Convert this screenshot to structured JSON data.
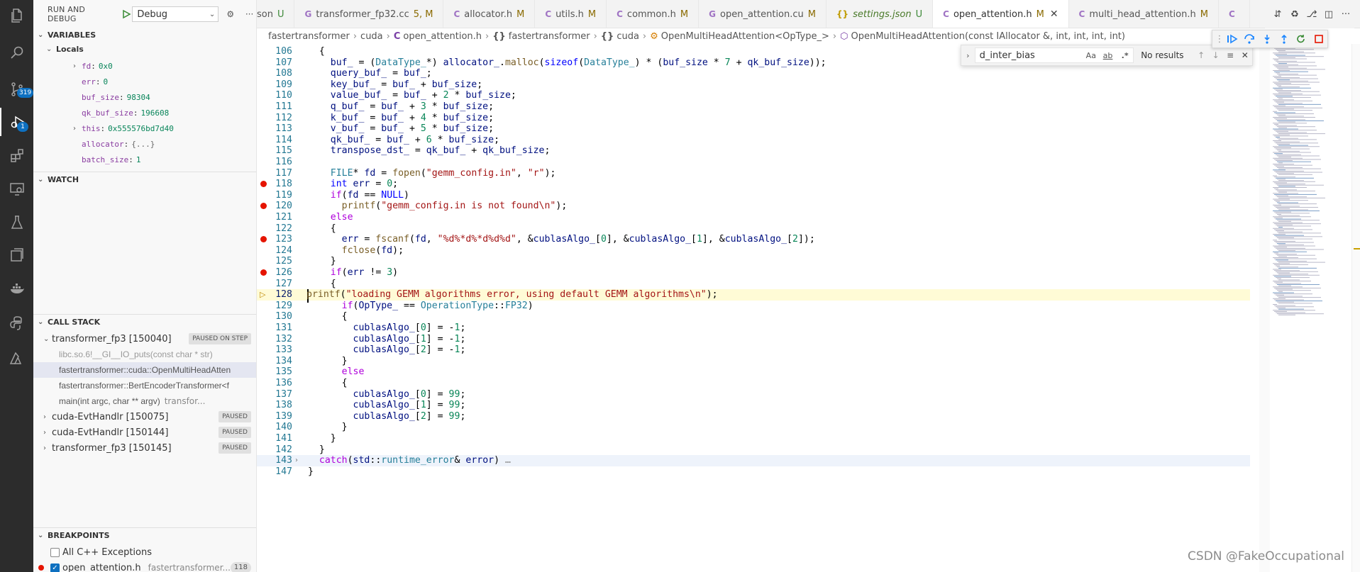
{
  "activity_bar": {
    "scm_badge": "319",
    "debug_badge": "1"
  },
  "sidebar": {
    "title": "RUN AND DEBUG",
    "config": "Debug",
    "variables_header": "VARIABLES",
    "locals_header": "Locals",
    "variables": [
      {
        "name": "fd",
        "value": "0x0",
        "expandable": true
      },
      {
        "name": "err",
        "value": "0",
        "expandable": false
      },
      {
        "name": "buf_size",
        "value": "98304",
        "expandable": false
      },
      {
        "name": "qk_buf_size",
        "value": "196608",
        "expandable": false
      },
      {
        "name": "this",
        "value": "0x555576bd7d40",
        "expandable": true
      },
      {
        "name": "allocator",
        "value": "{...}",
        "expandable": false
      },
      {
        "name": "batch_size",
        "value": "1",
        "expandable": false
      }
    ],
    "watch_header": "WATCH",
    "callstack_header": "CALL STACK",
    "callstack": [
      {
        "label": "transformer_fp3 [150040]",
        "badge": "PAUSED ON STEP",
        "kind": "thread",
        "expanded": true
      },
      {
        "label": "libc.so.6!__GI__IO_puts(const char * str)",
        "badge": "",
        "kind": "frame"
      },
      {
        "label": "fastertransformer::cuda::OpenMultiHeadAtten",
        "badge": "",
        "kind": "frame",
        "selected": true
      },
      {
        "label": "fastertransformer::BertEncoderTransformer<f",
        "badge": "",
        "kind": "frame"
      },
      {
        "label": "main(int argc, char ** argv)",
        "file": "transfor...",
        "badge": "",
        "kind": "frame"
      },
      {
        "label": "cuda-EvtHandlr [150075]",
        "badge": "PAUSED",
        "kind": "thread",
        "expanded": false
      },
      {
        "label": "cuda-EvtHandlr [150144]",
        "badge": "PAUSED",
        "kind": "thread",
        "expanded": false
      },
      {
        "label": "transformer_fp3 [150145]",
        "badge": "PAUSED",
        "kind": "thread",
        "expanded": false
      }
    ],
    "breakpoints_header": "BREAKPOINTS",
    "breakpoints": [
      {
        "label": "All C++ Exceptions",
        "checked": false
      },
      {
        "label": "open_attention.h",
        "path": "fastertransformer...",
        "line": "118",
        "checked": true
      }
    ]
  },
  "tabs": [
    {
      "label": "son",
      "status": "U",
      "icon": "",
      "icon_color": "#c09b00"
    },
    {
      "label": "transformer_fp32.cc",
      "status": "5, M",
      "icon": "G",
      "icon_color": "#a074c4"
    },
    {
      "label": "allocator.h",
      "status": "M",
      "icon": "C",
      "icon_color": "#a074c4"
    },
    {
      "label": "utils.h",
      "status": "M",
      "icon": "C",
      "icon_color": "#a074c4"
    },
    {
      "label": "common.h",
      "status": "M",
      "icon": "C",
      "icon_color": "#a074c4"
    },
    {
      "label": "open_attention.cu",
      "status": "M",
      "icon": "G",
      "icon_color": "#a074c4"
    },
    {
      "label": "settings.json",
      "status": "U",
      "icon": "{}",
      "icon_color": "#c09b00"
    },
    {
      "label": "open_attention.h",
      "status": "M",
      "icon": "C",
      "icon_color": "#a074c4",
      "active": true
    },
    {
      "label": "multi_head_attention.h",
      "status": "M",
      "icon": "C",
      "icon_color": "#a074c4"
    },
    {
      "label": "",
      "status": "",
      "icon": "C",
      "icon_color": "#a074c4"
    }
  ],
  "breadcrumb": [
    "fastertransformer",
    "cuda",
    "open_attention.h",
    "fastertransformer",
    "cuda",
    "OpenMultiHeadAttention<OpType_>",
    "OpenMultiHeadAttention(const IAllocator &, int, int, int, int)"
  ],
  "find": {
    "query": "d_inter_bias",
    "opt_case": "Aa",
    "opt_word": "ab",
    "opt_regex": ".*",
    "result": "No results"
  },
  "code_lines": [
    {
      "n": "106",
      "bp": false,
      "html": "  <span>{</span>"
    },
    {
      "n": "107",
      "bp": false,
      "html": "    <span class='id'>buf_</span> = (<span class='ty'>DataType_</span>*) <span class='id'>allocator_</span>.<span class='fn'>malloc</span>(<span class='kw'>sizeof</span>(<span class='ty'>DataType_</span>) * (<span class='id'>buf_size</span> * <span class='num'>7</span> + <span class='id'>qk_buf_size</span>));"
    },
    {
      "n": "108",
      "bp": false,
      "html": "    <span class='id'>query_buf_</span> = <span class='id'>buf_</span>;"
    },
    {
      "n": "109",
      "bp": false,
      "html": "    <span class='id'>key_buf_</span> = <span class='id'>buf_</span> + <span class='id'>buf_size</span>;"
    },
    {
      "n": "110",
      "bp": false,
      "html": "    <span class='id'>value_buf_</span> = <span class='id'>buf_</span> + <span class='num'>2</span> * <span class='id'>buf_size</span>;"
    },
    {
      "n": "111",
      "bp": false,
      "html": "    <span class='id'>q_buf_</span> = <span class='id'>buf_</span> + <span class='num'>3</span> * <span class='id'>buf_size</span>;"
    },
    {
      "n": "112",
      "bp": false,
      "html": "    <span class='id'>k_buf_</span> = <span class='id'>buf_</span> + <span class='num'>4</span> * <span class='id'>buf_size</span>;"
    },
    {
      "n": "113",
      "bp": false,
      "html": "    <span class='id'>v_buf_</span> = <span class='id'>buf_</span> + <span class='num'>5</span> * <span class='id'>buf_size</span>;"
    },
    {
      "n": "114",
      "bp": false,
      "html": "    <span class='id'>qk_buf_</span> = <span class='id'>buf_</span> + <span class='num'>6</span> * <span class='id'>buf_size</span>;"
    },
    {
      "n": "115",
      "bp": false,
      "html": "    <span class='id'>transpose_dst_</span> = <span class='id'>qk_buf_</span> + <span class='id'>qk_buf_size</span>;"
    },
    {
      "n": "116",
      "bp": false,
      "html": ""
    },
    {
      "n": "117",
      "bp": false,
      "html": "    <span class='ty'>FILE</span>* <span class='id'>fd</span> = <span class='fn'>fopen</span>(<span class='str'>\"gemm_config.in\"</span>, <span class='str'>\"r\"</span>);"
    },
    {
      "n": "118",
      "bp": true,
      "html": "    <span class='kw'>int</span> <span class='id'>err</span> = <span class='num'>0</span>;"
    },
    {
      "n": "119",
      "bp": false,
      "html": "    <span class='kwc'>if</span>(<span class='id'>fd</span> == <span class='kw'>NULL</span>)"
    },
    {
      "n": "120",
      "bp": true,
      "html": "      <span class='fn'>printf</span>(<span class='str'>\"gemm_config.in is not found\\n\"</span>);"
    },
    {
      "n": "121",
      "bp": false,
      "html": "    <span class='kwc'>else</span>"
    },
    {
      "n": "122",
      "bp": false,
      "html": "    <span>{</span>"
    },
    {
      "n": "123",
      "bp": true,
      "html": "      <span class='id'>err</span> = <span class='fn'>fscanf</span>(<span class='id'>fd</span>, <span class='str'>\"%d%*d%*d%d%d\"</span>, &amp;<span class='id'>cublasAlgo_</span>[<span class='num'>0</span>], &amp;<span class='id'>cublasAlgo_</span>[<span class='num'>1</span>], &amp;<span class='id'>cublasAlgo_</span>[<span class='num'>2</span>]);"
    },
    {
      "n": "124",
      "bp": false,
      "html": "      <span class='fn'>fclose</span>(<span class='id'>fd</span>);"
    },
    {
      "n": "125",
      "bp": false,
      "html": "    <span>}</span>"
    },
    {
      "n": "126",
      "bp": true,
      "html": "    <span class='kwc'>if</span>(<span class='id'>err</span> != <span class='num'>3</span>)"
    },
    {
      "n": "127",
      "bp": false,
      "html": "    <span>{</span>"
    },
    {
      "n": "128",
      "bp": false,
      "current": true,
      "html": "<span class='fn'>printf</span>(<span class='str'>\"loading GEMM algorithms error, using default GEMM algorithms\\n\"</span>);"
    },
    {
      "n": "129",
      "bp": false,
      "html": "      <span class='kwc'>if</span>(<span class='id'>OpType_</span> == <span class='ty'>OperationType</span>::<span class='ty'>FP32</span>)"
    },
    {
      "n": "130",
      "bp": false,
      "html": "      <span>{</span>"
    },
    {
      "n": "131",
      "bp": false,
      "html": "        <span class='id'>cublasAlgo_</span>[<span class='num'>0</span>] = -<span class='num'>1</span>;"
    },
    {
      "n": "132",
      "bp": false,
      "html": "        <span class='id'>cublasAlgo_</span>[<span class='num'>1</span>] = -<span class='num'>1</span>;"
    },
    {
      "n": "133",
      "bp": false,
      "html": "        <span class='id'>cublasAlgo_</span>[<span class='num'>2</span>] = -<span class='num'>1</span>;"
    },
    {
      "n": "134",
      "bp": false,
      "html": "      <span>}</span>"
    },
    {
      "n": "135",
      "bp": false,
      "html": "      <span class='kwc'>else</span>"
    },
    {
      "n": "136",
      "bp": false,
      "html": "      <span>{</span>"
    },
    {
      "n": "137",
      "bp": false,
      "html": "        <span class='id'>cublasAlgo_</span>[<span class='num'>0</span>] = <span class='num'>99</span>;"
    },
    {
      "n": "138",
      "bp": false,
      "html": "        <span class='id'>cublasAlgo_</span>[<span class='num'>1</span>] = <span class='num'>99</span>;"
    },
    {
      "n": "139",
      "bp": false,
      "html": "        <span class='id'>cublasAlgo_</span>[<span class='num'>2</span>] = <span class='num'>99</span>;"
    },
    {
      "n": "140",
      "bp": false,
      "html": "      <span>}</span>"
    },
    {
      "n": "141",
      "bp": false,
      "html": "    <span>}</span>"
    },
    {
      "n": "142",
      "bp": false,
      "html": "  <span>}</span>"
    },
    {
      "n": "143",
      "bp": false,
      "folded": true,
      "html": "  <span class='kwc'>catch</span>(<span class='id'>std</span>::<span class='ty'>runtime_error</span>&amp; <span class='id'>error</span>) <span class='ell'>…</span>"
    },
    {
      "n": "147",
      "bp": false,
      "html": "}"
    }
  ],
  "watermark": "CSDN @FakeOccupational"
}
